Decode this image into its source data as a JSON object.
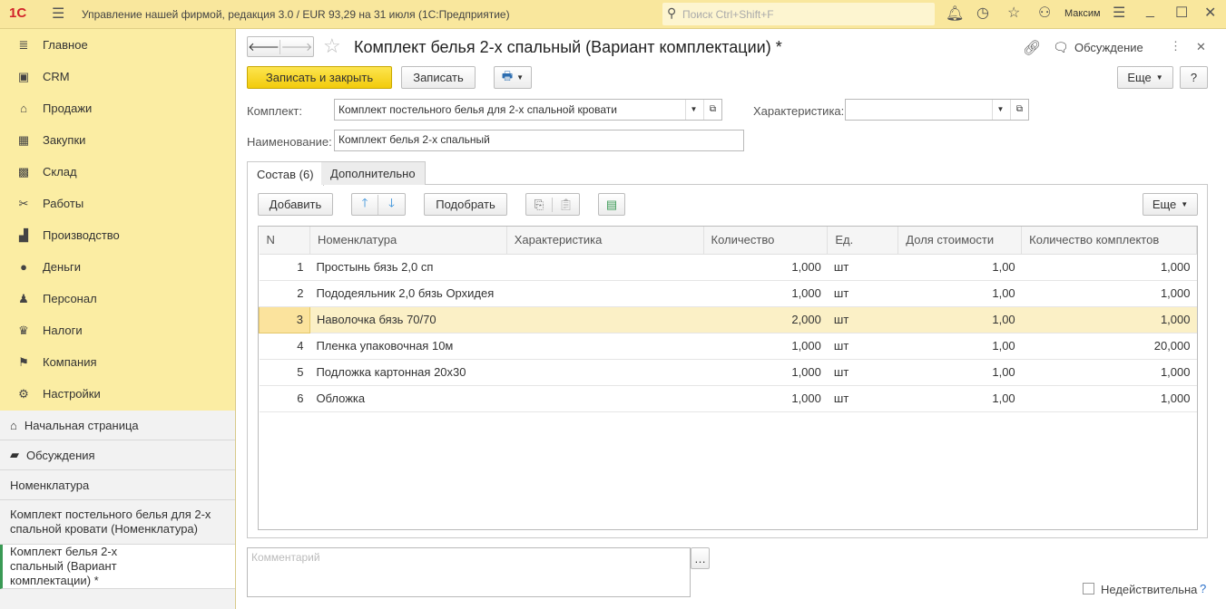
{
  "topbar": {
    "title": "Управление нашей фирмой, редакция 3.0 / EUR 93,29 на 31 июля  (1С:Предприятие)",
    "search_placeholder": "Поиск Ctrl+Shift+F",
    "user": "Максим",
    "logo": "1С"
  },
  "sidebar": {
    "items": [
      {
        "label": "Главное",
        "icon": "menu-icon"
      },
      {
        "label": "CRM",
        "icon": "contact-card-icon"
      },
      {
        "label": "Продажи",
        "icon": "basket-icon"
      },
      {
        "label": "Закупки",
        "icon": "cart-icon"
      },
      {
        "label": "Склад",
        "icon": "warehouse-icon"
      },
      {
        "label": "Работы",
        "icon": "tools-icon"
      },
      {
        "label": "Производство",
        "icon": "factory-icon"
      },
      {
        "label": "Деньги",
        "icon": "coin-icon"
      },
      {
        "label": "Персонал",
        "icon": "people-icon"
      },
      {
        "label": "Налоги",
        "icon": "eagle-icon"
      },
      {
        "label": "Компания",
        "icon": "flag-icon"
      },
      {
        "label": "Настройки",
        "icon": "gear-icon"
      }
    ]
  },
  "open_windows": [
    {
      "label": "Начальная страница"
    },
    {
      "label": "Обсуждения"
    },
    {
      "label": "Номенклатура"
    },
    {
      "label": "Комплект постельного белья для 2-х спальной кровати (Номенклатура)"
    },
    {
      "label": "Комплект белья 2-х спальный (Вариант комплектации) *"
    }
  ],
  "form": {
    "title": "Комплект белья 2-х спальный (Вариант комплектации) *",
    "discussion": "Обсуждение",
    "save_close": "Записать и закрыть",
    "save": "Записать",
    "more": "Еще",
    "help": "?",
    "komplekt_label": "Комплект:",
    "komplekt_value": "Комплект постельного белья для 2-х спальной кровати",
    "char_label": "Характеристика:",
    "char_value": "",
    "name_label": "Наименование:",
    "name_value": "Комплект белья 2-х спальный",
    "tabs": [
      {
        "label": "Состав (6)",
        "active": true
      },
      {
        "label": "Дополнительно",
        "active": false
      }
    ],
    "add": "Добавить",
    "pick": "Подобрать",
    "comment_placeholder": "Комментарий",
    "inactive_label": "Недействительна",
    "inactive_checked": false
  },
  "table": {
    "columns": [
      "N",
      "Номенклатура",
      "Характеристика",
      "Количество",
      "Ед.",
      "Доля стоимости",
      "Количество комплектов"
    ],
    "rows": [
      [
        "1",
        "Простынь бязь 2,0 сп",
        "",
        "1,000",
        "шт",
        "1,00",
        "1,000"
      ],
      [
        "2",
        "Пододеяльник 2,0 бязь Орхидея",
        "",
        "1,000",
        "шт",
        "1,00",
        "1,000"
      ],
      [
        "3",
        "Наволочка бязь 70/70",
        "",
        "2,000",
        "шт",
        "1,00",
        "1,000"
      ],
      [
        "4",
        "Пленка упаковочная 10м",
        "",
        "1,000",
        "шт",
        "1,00",
        "20,000"
      ],
      [
        "5",
        "Подложка картонная 20х30",
        "",
        "1,000",
        "шт",
        "1,00",
        "1,000"
      ],
      [
        "6",
        "Обложка",
        "",
        "1,000",
        "шт",
        "1,00",
        "1,000"
      ]
    ],
    "selected_row": 3
  },
  "colors": {
    "accent": "#f9e79d",
    "sidebar": "#fbeda3",
    "primary_button": "#f5d218",
    "selected_row": "#fbf0c6"
  }
}
